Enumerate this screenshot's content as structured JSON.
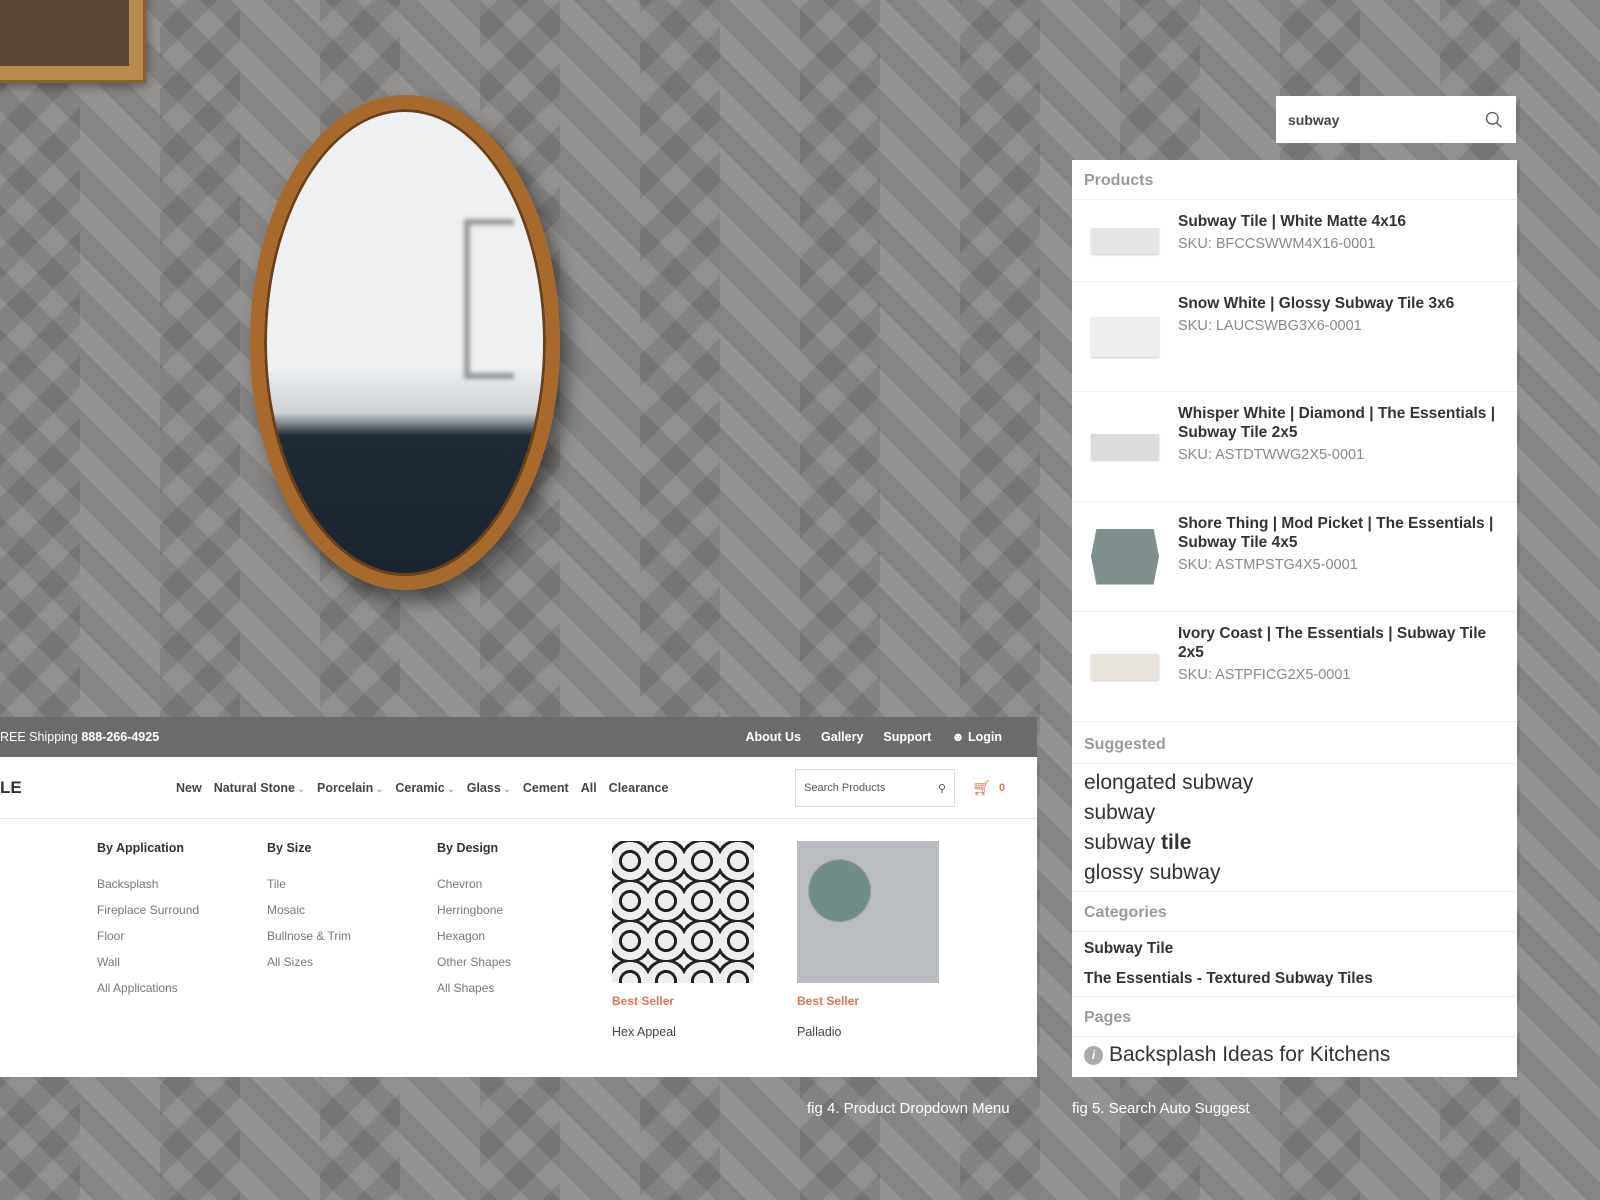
{
  "search": {
    "value": "subway"
  },
  "autosuggest": {
    "products_heading": "Products",
    "products": [
      {
        "name": "Subway Tile | White Matte 4x16",
        "sku": "SKU: BFCCSWWM4X16-0001",
        "color": "#e6e6e4"
      },
      {
        "name": "Snow White | Glossy Subway Tile 3x6",
        "sku": "SKU: LAUCSWBG3X6-0001",
        "color": "#eeeeec"
      },
      {
        "name": "Whisper White | Diamond | The Essentials | Subway Tile 2x5",
        "sku": "SKU: ASTDTWWG2X5-0001",
        "color": "#dcdcda"
      },
      {
        "name": "Shore Thing | Mod Picket | The Essentials | Subway Tile 4x5",
        "sku": "SKU: ASTMPSTG4X5-0001",
        "color": "#7e8f8e"
      },
      {
        "name": "Ivory Coast | The Essentials | Subway Tile 2x5",
        "sku": "SKU: ASTPFICG2X5-0001",
        "color": "#e8e4dc"
      }
    ],
    "suggested_heading": "Suggested",
    "suggested": [
      {
        "pre": "elongated subway",
        "bold": ""
      },
      {
        "pre": "subway",
        "bold": ""
      },
      {
        "pre": "subway ",
        "bold": "tile"
      },
      {
        "pre": "glossy subway",
        "bold": ""
      }
    ],
    "categories_heading": "Categories",
    "categories": [
      "Subway Tile",
      "The Essentials - Textured Subway Tiles"
    ],
    "pages_heading": "Pages",
    "pages": [
      "Backsplash Ideas for Kitchens"
    ],
    "info_glyph": "i"
  },
  "site": {
    "shipping": "REE Shipping",
    "phone": "888-266-4925",
    "top_links": [
      "About Us",
      "Gallery",
      "Support",
      "Login"
    ],
    "logo": "LE",
    "menu": [
      "New",
      "Natural Stone",
      "Porcelain",
      "Ceramic",
      "Glass",
      "Cement",
      "All",
      "Clearance"
    ],
    "search_placeholder": "Search Products",
    "cart_count": "0",
    "columns": [
      {
        "heading": "By Application",
        "items": [
          "Backsplash",
          "Fireplace Surround",
          "Floor",
          "Wall",
          "All Applications"
        ]
      },
      {
        "heading": "By Size",
        "items": [
          "Tile",
          "Mosaic",
          "Bullnose & Trim",
          "All Sizes"
        ]
      },
      {
        "heading": "By Design",
        "items": [
          "Chevron",
          "Herringbone",
          "Hexagon",
          "Other Shapes",
          "All Shapes"
        ]
      }
    ],
    "featured": [
      {
        "badge": "Best Seller",
        "name": "Hex Appeal"
      },
      {
        "badge": "Best Seller",
        "name": "Palladio"
      }
    ]
  },
  "captions": {
    "fig4": "fig 4. Product Dropdown Menu",
    "fig5": "fig 5. Search Auto Suggest"
  },
  "colors": {
    "accent": "#e2744f",
    "topbar": "#6b6b6b"
  }
}
